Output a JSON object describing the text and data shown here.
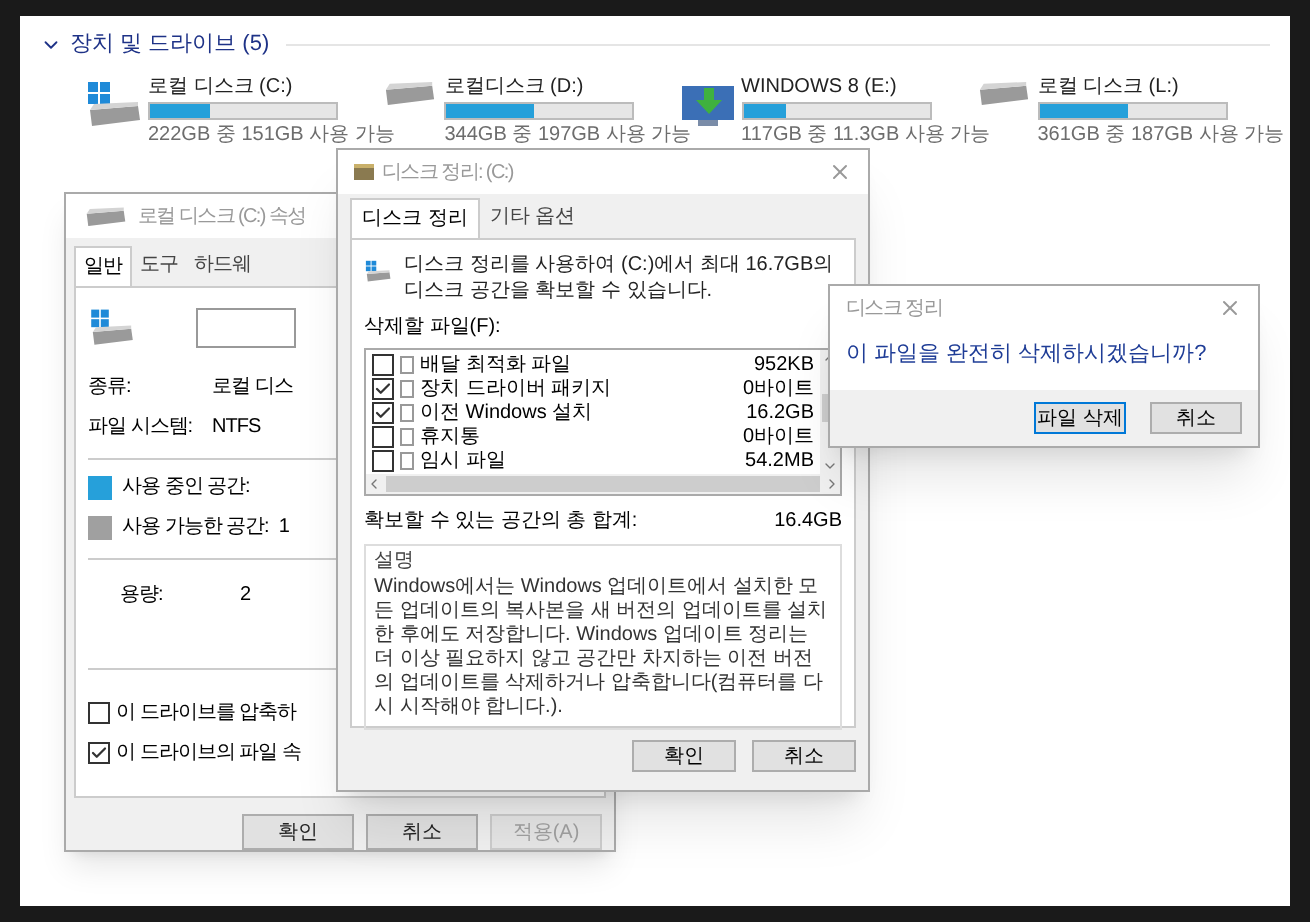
{
  "section": {
    "title": "장치 및 드라이브 (5)",
    "expanded": true
  },
  "drives": [
    {
      "kind": "windows",
      "name": "로컬 디스크 (C:)",
      "level": 0.32,
      "usage": "222GB 중 151GB 사용 가능"
    },
    {
      "kind": "disk",
      "name": "로컬디스크 (D:)",
      "level": 0.47,
      "usage": "344GB 중 197GB 사용 가능"
    },
    {
      "kind": "install",
      "name": "WINDOWS 8 (E:)",
      "level": 0.23,
      "usage": "117GB 중 11.3GB 사용 가능"
    },
    {
      "kind": "disk",
      "name": "로컬 디스크 (L:)",
      "level": 0.48,
      "usage": "361GB 중 187GB 사용 가능"
    }
  ],
  "properties_window": {
    "title": "로컬 디스크 (C:) 속성",
    "tabs": [
      {
        "label": "일반",
        "selected": true
      },
      {
        "label": "도구",
        "selected": false
      },
      {
        "label": "하드웨",
        "selected": false
      }
    ],
    "info": [
      {
        "label": "종류:",
        "value": "로컬 디스"
      },
      {
        "label": "파일 시스템:",
        "value": "NTFS"
      }
    ],
    "space": [
      {
        "label": "사용 중인 공간:",
        "color": "#26a0da"
      },
      {
        "label": "사용 가능한 공간:",
        "color": "#a0a0a0",
        "value": "1"
      }
    ],
    "capacity": {
      "label": "용량:",
      "value": "2"
    },
    "checkboxes": [
      {
        "label": "이 드라이브를 압축하",
        "checked": false
      },
      {
        "label": "이 드라이브의 파일 속",
        "checked": true
      }
    ],
    "buttons": [
      {
        "label": "확인",
        "disabled": false
      },
      {
        "label": "취소",
        "disabled": false
      },
      {
        "label": "적용(A)",
        "disabled": true
      }
    ]
  },
  "cleanup_window": {
    "title": "디스크 정리: (C:)",
    "tabs": [
      {
        "label": "디스크 정리",
        "selected": true
      },
      {
        "label": "기타 옵션",
        "selected": false
      }
    ],
    "intro": "디스크 정리를 사용하여 (C:)에서 최대 16.7GB의 디스크 공간을 확보할 수 있습니다.",
    "list_label": "삭제할 파일(F):",
    "files": [
      {
        "name": "배달 최적화 파일",
        "size": "952KB",
        "checked": false
      },
      {
        "name": "장치 드라이버 패키지",
        "size": "0바이트",
        "checked": true
      },
      {
        "name": "이전 Windows 설치",
        "size": "16.2GB",
        "checked": true
      },
      {
        "name": "휴지통",
        "size": "0바이트",
        "checked": false
      },
      {
        "name": "임시 파일",
        "size": "54.2MB",
        "checked": false
      }
    ],
    "total_label": "확보할 수 있는 공간의 총 합계:",
    "total_value": "16.4GB",
    "description_title": "설명",
    "description": "Windows에서는 Windows 업데이트에서 설치한 모든 업데이트의 복사본을 새 버전의 업데이트를 설치한 후에도 저장합니다. Windows 업데이트 정리는 더 이상 필요하지 않고 공간만 차지하는 이전 버전의 업데이트를 삭제하거나 압축합니다(컴퓨터를 다시 시작해야 합니다.).",
    "buttons": [
      "확인",
      "취소"
    ]
  },
  "confirm_dialog": {
    "title": "디스크 정리",
    "message": "이 파일을 완전히 삭제하시겠습니까?",
    "buttons": [
      {
        "label": "파일 삭제",
        "default": true
      },
      {
        "label": "취소",
        "default": false
      }
    ]
  }
}
